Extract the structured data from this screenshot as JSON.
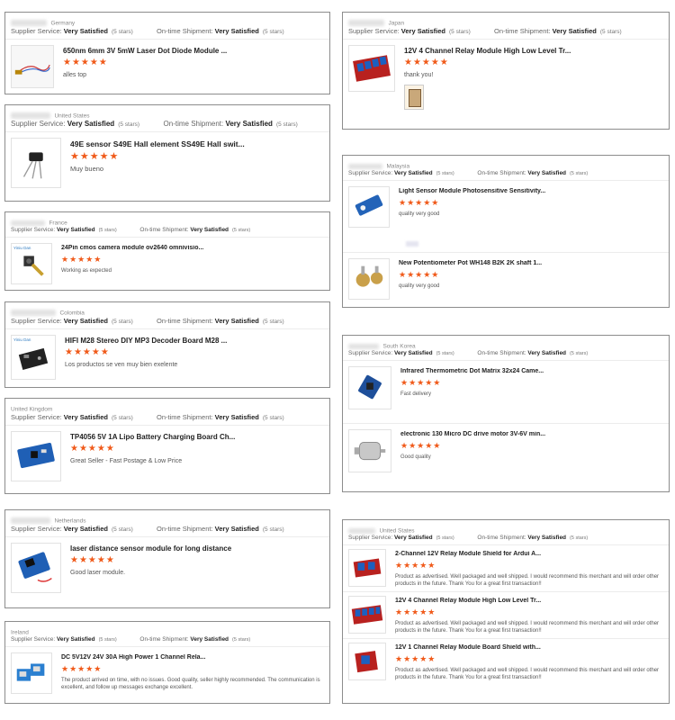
{
  "labels": {
    "supplier_service": "Supplier Service:",
    "ontime_shipment": "On-time Shipment:",
    "very_satisfied": "Very Satisfied",
    "five_stars": "(5 stars)",
    "star_glyphs": "★★★★★"
  },
  "left": [
    {
      "country": "Germany",
      "items": [
        {
          "title": "650nm 6mm 3V 5mW Laser Dot Diode Module ...",
          "review": "alles top",
          "rating": 5,
          "thumb": "laser-diode"
        }
      ]
    },
    {
      "country": "United States",
      "items": [
        {
          "title": "49E sensor S49E Hall element SS49E Hall swit...",
          "review": "Muy bueno",
          "rating": 5,
          "thumb": "hall-sensor"
        }
      ]
    },
    {
      "country": "France",
      "items": [
        {
          "title": "24Pin cmos camera module ov2640 omnivisio...",
          "review": "Working as expected",
          "rating": 5,
          "thumb": "camera-module",
          "tag": "Yiniu Dan"
        }
      ]
    },
    {
      "country": "Colombia",
      "items": [
        {
          "title": "HIFI M28 Stereo DIY MP3 Decoder Board M28 ...",
          "review": "Los productos se ven muy bien exelente",
          "rating": 5,
          "thumb": "mp3-board",
          "tag": "Yiniu Dan"
        }
      ]
    },
    {
      "country": "United Kingdom",
      "items": [
        {
          "title": "TP4056 5V 1A Lipo Battery Charging Board Ch...",
          "review": "Great Seller - Fast Postage & Low Price",
          "rating": 5,
          "thumb": "charger-board"
        }
      ]
    },
    {
      "country": "Netherlands",
      "items": [
        {
          "title": "laser distance sensor module for long distance",
          "review": "Good laser module.",
          "rating": 5,
          "thumb": "distance-sensor"
        }
      ]
    },
    {
      "country": "Ireland",
      "items": [
        {
          "title": "DC 5V12V 24V 30A High Power 1 Channel Rela...",
          "review": "The product arrived on time, with no issues. Good quality, seller highly recommended. The communication is excellent, and follow up messages exchange excellent.",
          "rating": 5,
          "thumb": "relay-1ch"
        }
      ]
    }
  ],
  "right": [
    {
      "country": "Japan",
      "items": [
        {
          "title": "12V 4 Channel Relay Module High Low Level Tr...",
          "review": "thank you!",
          "rating": 5,
          "thumb": "relay-4ch",
          "photo": true
        }
      ]
    },
    {
      "country": "Malaysia",
      "items": [
        {
          "title": "Light Sensor Module Photosensitive Sensitivity...",
          "review": "quality very good",
          "rating": 5,
          "thumb": "light-sensor"
        },
        {
          "title": "New Potentiometer Pot WH148 B2K 2K shaft 1...",
          "review": "quality very good",
          "rating": 5,
          "thumb": "potentiometer"
        }
      ]
    },
    {
      "country": "South Korea",
      "items": [
        {
          "title": "Infrared Thermometric Dot Matrix 32x24 Came...",
          "review": "Fast delivery",
          "rating": 5,
          "thumb": "ir-sensor"
        },
        {
          "title": "electronic 130 Micro DC drive motor 3V-6V min...",
          "review": "Good quality",
          "rating": 5,
          "thumb": "dc-motor"
        }
      ]
    },
    {
      "country": "United States",
      "items": [
        {
          "title": "2-Channel 12V Relay Module Shield for Ardui A...",
          "review": "Product as advertised. Well packaged and well shipped. I would recommend this merchant and will order other products in the future.  Thank You for a great first transaction!!",
          "rating": 5,
          "thumb": "relay-2ch"
        },
        {
          "title": "12V 4 Channel Relay Module High Low Level Tr...",
          "review": "Product as advertised. Well packaged and well shipped. I would recommend this merchant and will order other products in the future.  Thank You for a great first transaction!!",
          "rating": 5,
          "thumb": "relay-4ch"
        },
        {
          "title": "12V 1 Channel Relay Module Board Shield with...",
          "review": "Product as advertised. Well packaged and well shipped. I would recommend this merchant and will order other products in the future.  Thank You for a great first transaction!!",
          "rating": 5,
          "thumb": "relay-1ch"
        }
      ]
    }
  ]
}
